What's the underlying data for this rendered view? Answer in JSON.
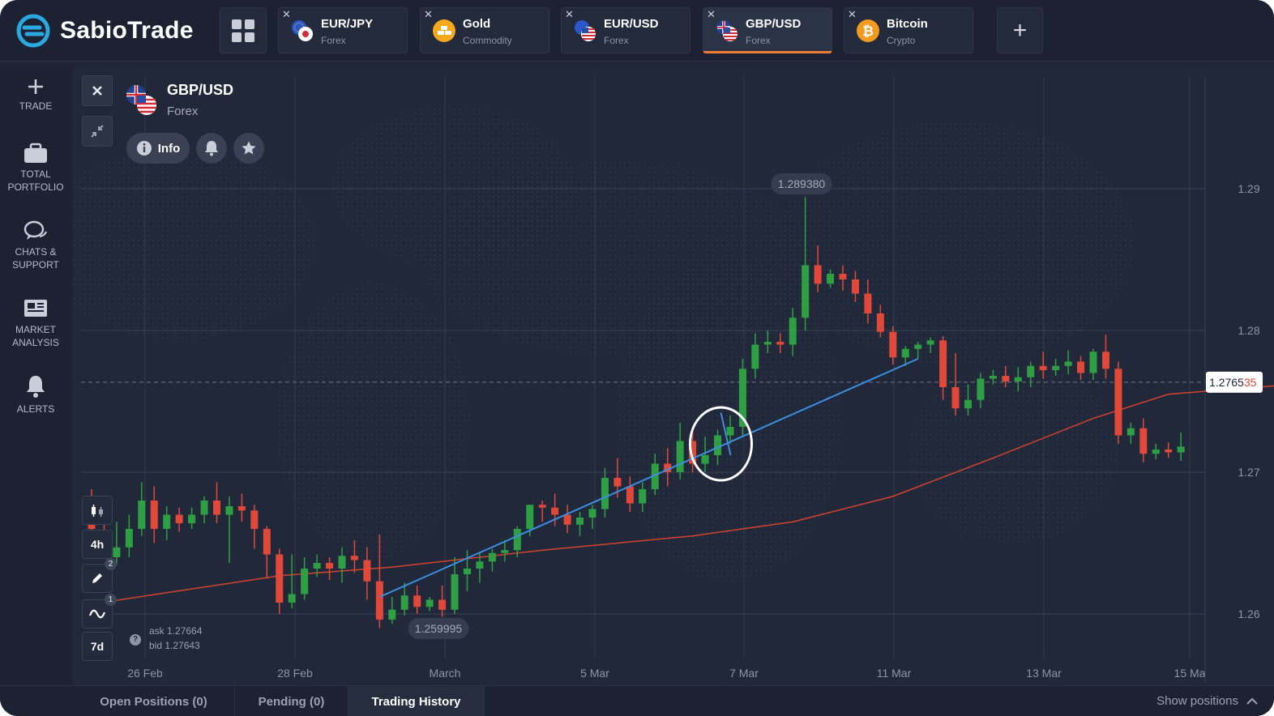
{
  "app": {
    "brand": "SabioTrade"
  },
  "tabs": [
    {
      "name": "EUR/JPY",
      "category": "Forex",
      "icon": "eur-jpy-flag-icon",
      "active": false
    },
    {
      "name": "Gold",
      "category": "Commodity",
      "icon": "gold-icon",
      "active": false
    },
    {
      "name": "EUR/USD",
      "category": "Forex",
      "icon": "eur-usd-flag-icon",
      "active": false
    },
    {
      "name": "GBP/USD",
      "category": "Forex",
      "icon": "gbp-usd-flag-icon",
      "active": true
    },
    {
      "name": "Bitcoin",
      "category": "Crypto",
      "icon": "bitcoin-icon",
      "active": false
    }
  ],
  "sidebar": {
    "items": [
      {
        "label": "TRADE",
        "icon": "plus-icon"
      },
      {
        "label": "TOTAL PORTFOLIO",
        "icon": "briefcase-icon"
      },
      {
        "label": "CHATS & SUPPORT",
        "icon": "chat-icon"
      },
      {
        "label": "MARKET ANALYSIS",
        "icon": "newspaper-icon"
      },
      {
        "label": "ALERTS",
        "icon": "bell-icon"
      }
    ]
  },
  "symbol": {
    "name": "GBP/USD",
    "category": "Forex",
    "info_label": "Info"
  },
  "tools": {
    "timeframe": "4h",
    "drawings_count": "2",
    "indicators_count": "1",
    "range": "7d"
  },
  "quote": {
    "ask": "ask 1.27664",
    "bid": "bid 1.27643"
  },
  "colors": {
    "up": "#2ea043",
    "down": "#e0493a",
    "trendline": "#3b8fe0",
    "moving_average": "#c9412f",
    "accent": "#ef7c35"
  },
  "chart_data": {
    "type": "candlestick",
    "symbol": "GBP/USD",
    "y_ticks": [
      "1.29",
      "1.28",
      "1.27",
      "1.26"
    ],
    "ylim": [
      1.2555,
      1.2985
    ],
    "x_ticks": [
      "26 Feb",
      "28 Feb",
      "March",
      "5 Mar",
      "7 Mar",
      "11 Mar",
      "13 Mar",
      "15 Ma"
    ],
    "high_label": "1.289380",
    "low_label": "1.259995",
    "current_price_main": "1.2765",
    "current_price_tail": "35",
    "current_price": 1.27635,
    "candles": [
      [
        1.2667,
        1.2688,
        1.266,
        1.2655
      ],
      [
        1.2655,
        1.2665,
        1.2645,
        1.264
      ],
      [
        1.264,
        1.2665,
        1.2647,
        1.2635
      ],
      [
        1.2647,
        1.267,
        1.266,
        1.264
      ],
      [
        1.266,
        1.2693,
        1.268,
        1.2655
      ],
      [
        1.268,
        1.269,
        1.266,
        1.265
      ],
      [
        1.266,
        1.2676,
        1.267,
        1.2652
      ],
      [
        1.267,
        1.2675,
        1.2664,
        1.2658
      ],
      [
        1.2664,
        1.2675,
        1.267,
        1.266
      ],
      [
        1.267,
        1.2683,
        1.268,
        1.2664
      ],
      [
        1.268,
        1.2693,
        1.267,
        1.2664
      ],
      [
        1.267,
        1.2683,
        1.2676,
        1.2636
      ],
      [
        1.2676,
        1.2685,
        1.2673,
        1.2665
      ],
      [
        1.2673,
        1.2677,
        1.266,
        1.2646
      ],
      [
        1.266,
        1.2662,
        1.2642,
        1.2625
      ],
      [
        1.2642,
        1.2646,
        1.2608,
        1.26
      ],
      [
        1.2608,
        1.2642,
        1.2614,
        1.2604
      ],
      [
        1.2614,
        1.264,
        1.2632,
        1.261
      ],
      [
        1.2632,
        1.2642,
        1.2636,
        1.2626
      ],
      [
        1.2636,
        1.264,
        1.2632,
        1.2624
      ],
      [
        1.2632,
        1.2647,
        1.2641,
        1.2622
      ],
      [
        1.2641,
        1.2652,
        1.2638,
        1.2629
      ],
      [
        1.2638,
        1.2647,
        1.2623,
        1.261
      ],
      [
        1.2623,
        1.2656,
        1.2596,
        1.259
      ],
      [
        1.2596,
        1.2612,
        1.2603,
        1.2593
      ],
      [
        1.2603,
        1.2622,
        1.2613,
        1.2599
      ],
      [
        1.2613,
        1.262,
        1.2605,
        1.26
      ],
      [
        1.2605,
        1.2612,
        1.261,
        1.2602
      ],
      [
        1.261,
        1.262,
        1.2603,
        1.2598
      ],
      [
        1.2603,
        1.264,
        1.2628,
        1.26
      ],
      [
        1.2628,
        1.2645,
        1.2632,
        1.2616
      ],
      [
        1.2632,
        1.2643,
        1.2637,
        1.2622
      ],
      [
        1.2637,
        1.2646,
        1.2643,
        1.263
      ],
      [
        1.2643,
        1.2652,
        1.2645,
        1.2637
      ],
      [
        1.2645,
        1.2662,
        1.266,
        1.264
      ],
      [
        1.266,
        1.2677,
        1.2677,
        1.2655
      ],
      [
        1.2677,
        1.268,
        1.2675,
        1.2665
      ],
      [
        1.2675,
        1.2685,
        1.267,
        1.2662
      ],
      [
        1.267,
        1.2677,
        1.2663,
        1.2657
      ],
      [
        1.2663,
        1.2672,
        1.2668,
        1.2655
      ],
      [
        1.2668,
        1.2677,
        1.2674,
        1.266
      ],
      [
        1.2674,
        1.2703,
        1.2696,
        1.2668
      ],
      [
        1.2696,
        1.271,
        1.269,
        1.2682
      ],
      [
        1.269,
        1.2697,
        1.2678,
        1.2672
      ],
      [
        1.2678,
        1.2693,
        1.2688,
        1.2672
      ],
      [
        1.2688,
        1.2713,
        1.2706,
        1.2684
      ],
      [
        1.2706,
        1.2717,
        1.27,
        1.269
      ],
      [
        1.27,
        1.2735,
        1.2722,
        1.2695
      ],
      [
        1.2722,
        1.2732,
        1.2706,
        1.27
      ],
      [
        1.2706,
        1.2725,
        1.2712,
        1.27
      ],
      [
        1.2712,
        1.273,
        1.2726,
        1.2705
      ],
      [
        1.2726,
        1.274,
        1.2732,
        1.272
      ],
      [
        1.2732,
        1.278,
        1.2773,
        1.2726
      ],
      [
        1.2773,
        1.2798,
        1.279,
        1.2766
      ],
      [
        1.279,
        1.28,
        1.2792,
        1.2784
      ],
      [
        1.2792,
        1.2798,
        1.279,
        1.2784
      ],
      [
        1.279,
        1.2816,
        1.2809,
        1.2782
      ],
      [
        1.2809,
        1.2894,
        1.2846,
        1.28
      ],
      [
        1.2846,
        1.286,
        1.2833,
        1.2827
      ],
      [
        1.2833,
        1.2843,
        1.284,
        1.283
      ],
      [
        1.284,
        1.2846,
        1.2836,
        1.2828
      ],
      [
        1.2836,
        1.2842,
        1.2826,
        1.282
      ],
      [
        1.2826,
        1.2836,
        1.2812,
        1.2805
      ],
      [
        1.2812,
        1.2818,
        1.2799,
        1.2795
      ],
      [
        1.2799,
        1.2803,
        1.2781,
        1.2776
      ],
      [
        1.2781,
        1.2789,
        1.2787,
        1.2775
      ],
      [
        1.2787,
        1.2792,
        1.279,
        1.278
      ],
      [
        1.279,
        1.2795,
        1.2793,
        1.2784
      ],
      [
        1.2793,
        1.2796,
        1.276,
        1.2751
      ],
      [
        1.276,
        1.2784,
        1.2745,
        1.274
      ],
      [
        1.2745,
        1.2762,
        1.2751,
        1.274
      ],
      [
        1.2751,
        1.277,
        1.2766,
        1.2745
      ],
      [
        1.2766,
        1.2772,
        1.2768,
        1.2762
      ],
      [
        1.2768,
        1.2775,
        1.2764,
        1.276
      ],
      [
        1.2764,
        1.2774,
        1.2767,
        1.2757
      ],
      [
        1.2767,
        1.2778,
        1.2775,
        1.276
      ],
      [
        1.2775,
        1.2785,
        1.2772,
        1.2766
      ],
      [
        1.2772,
        1.278,
        1.2775,
        1.2768
      ],
      [
        1.2775,
        1.2786,
        1.2778,
        1.2769
      ],
      [
        1.2778,
        1.2782,
        1.277,
        1.2765
      ],
      [
        1.277,
        1.2787,
        1.2785,
        1.2765
      ],
      [
        1.2785,
        1.2797,
        1.2773,
        1.2766
      ],
      [
        1.2773,
        1.2778,
        1.2726,
        1.272
      ],
      [
        1.2726,
        1.2735,
        1.2731,
        1.272
      ],
      [
        1.2731,
        1.2738,
        1.2713,
        1.2707
      ],
      [
        1.2713,
        1.272,
        1.2716,
        1.2709
      ],
      [
        1.2716,
        1.2721,
        1.2714,
        1.271
      ],
      [
        1.2714,
        1.2728,
        1.2718,
        1.2708
      ]
    ],
    "moving_average": [
      [
        0,
        1.2607
      ],
      [
        15,
        1.2627
      ],
      [
        24,
        1.2633
      ],
      [
        36,
        1.2645
      ],
      [
        48,
        1.2655
      ],
      [
        56,
        1.2665
      ],
      [
        64,
        1.2683
      ],
      [
        72,
        1.271
      ],
      [
        80,
        1.2738
      ],
      [
        86,
        1.2755
      ],
      [
        96,
        1.2762
      ]
    ],
    "trendline": {
      "from": [
        23,
        1.2612
      ],
      "to": [
        66,
        1.278
      ]
    },
    "highlight_candle": 50
  },
  "bottom": {
    "tabs": [
      {
        "label": "Open Positions (0)",
        "active": false
      },
      {
        "label": "Pending (0)",
        "active": false
      },
      {
        "label": "Trading History",
        "active": true
      }
    ],
    "show_positions": "Show positions"
  }
}
